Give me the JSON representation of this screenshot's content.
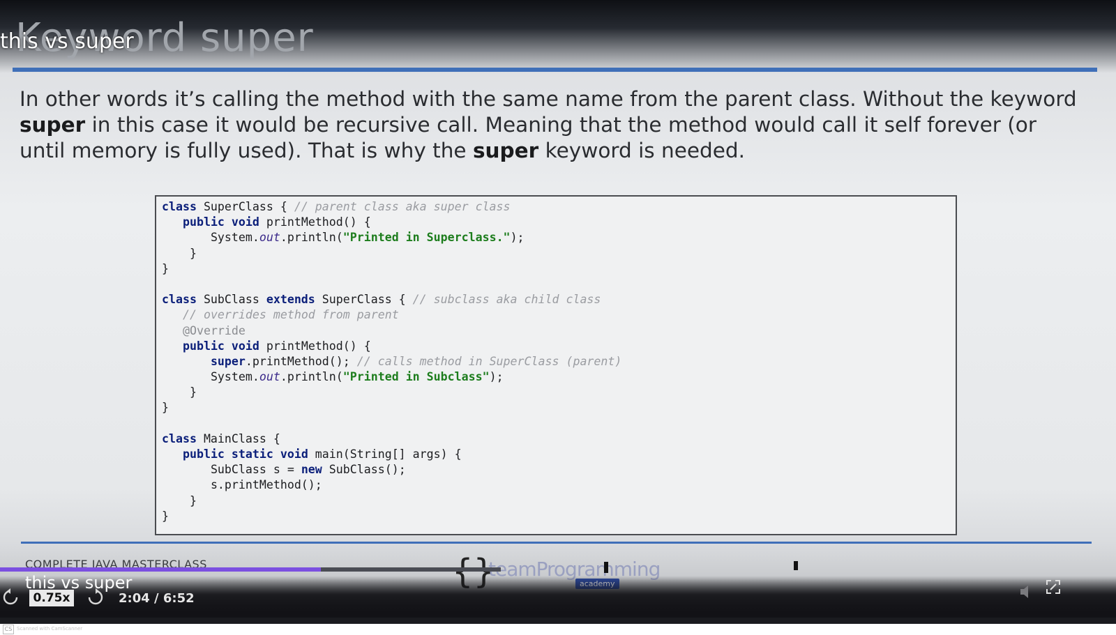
{
  "slide": {
    "title": "Keyword super",
    "paragraph": {
      "part1": "In other words it’s calling the method with the same name from the parent class. Without the keyword ",
      "bold1": "super",
      "part2": " in this case it would be recursive call. Meaning that the method would call it self forever (or until memory is fully used). That is why the ",
      "bold2": "super",
      "part3": " keyword is needed."
    },
    "footer_course": "COMPLETE JAVA MASTERCLASS",
    "logo": {
      "text": "teamProgramming",
      "badge": "academy"
    }
  },
  "code": {
    "l1_kw": "class",
    "l1_name": " SuperClass { ",
    "l1_cm": "// parent class aka super class",
    "l2_kw": "public void",
    "l2_rest": " printMethod() {",
    "l3_pre": "System.",
    "l3_out": "out",
    "l3_mid": ".println(",
    "l3_str": "\"Printed in Superclass.\"",
    "l3_end": ");",
    "l4": "}",
    "l5": "}",
    "l7_kw": "class",
    "l7_name": " SubClass ",
    "l7_kw2": "extends",
    "l7_rest": " SuperClass { ",
    "l7_cm": "// subclass aka child class",
    "l8_cm": "// overrides method from parent",
    "l9_an": "@Override",
    "l10_kw": "public void",
    "l10_rest": " printMethod() {",
    "l11_kw": "super",
    "l11_rest": ".printMethod(); ",
    "l11_cm": "// calls method in SuperClass (parent)",
    "l12_pre": "System.",
    "l12_out": "out",
    "l12_mid": ".println(",
    "l12_str": "\"Printed in Subclass\"",
    "l12_end": ");",
    "l13": "}",
    "l14": "}",
    "l16_kw": "class",
    "l16_rest": " MainClass {",
    "l17_kw": "public static void",
    "l17_rest": " main(String[] args) {",
    "l18_pre": "SubClass s = ",
    "l18_kw": "new",
    "l18_rest": " SubClass();",
    "l19": "s.printMethod();",
    "l20": "}",
    "l21": "}"
  },
  "player": {
    "overlay_title": "this vs super",
    "video_title": "this vs super",
    "speed": "0.75x",
    "time": "2:04 / 6:52",
    "progress_fraction": 0.301,
    "icons": {
      "rewind": "rewind-icon",
      "forward": "forward-icon",
      "volume": "volume-muted-icon",
      "fullscreen": "fullscreen-icon"
    },
    "colors": {
      "progress": "#7b4fe0",
      "accent": "#3f6fb8"
    }
  },
  "scanner_watermark": "Scanned with CamScanner"
}
